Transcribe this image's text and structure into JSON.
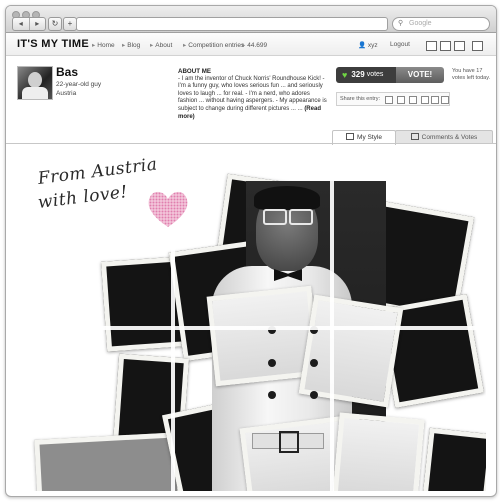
{
  "browser": {
    "nav_back": "◂",
    "nav_forward": "▸",
    "reload_icon": "reload-icon",
    "add_icon": "plus-icon",
    "search_placeholder": "Google"
  },
  "site": {
    "logo": "IT'S MY TIME",
    "nav": [
      {
        "label": "Home"
      },
      {
        "label": "Blog"
      },
      {
        "label": "About"
      },
      {
        "label": "Competition entries"
      },
      {
        "label": "44.699"
      }
    ],
    "user": "xyz",
    "logout": "Logout"
  },
  "profile": {
    "name": "Bas",
    "age_line": "22-year-old guy",
    "country": "Austria",
    "about_heading": "ABOUT ME",
    "about_text": "- I am the inventor of Chuck Norris' Roundhouse Kick! - I'm a funny guy, who loves serious fun ... and seriously loves to laugh ... for real. - I'm a nerd, who adores fashion ... without having aspergers. - My appearance is subject to change during different pictures ... ...",
    "read_more": "(Read more)"
  },
  "votes": {
    "count": "329",
    "unit": "votes",
    "button": "VOTE!",
    "left_note": "You have 17 votes left today."
  },
  "share": {
    "label": "Share this entry:"
  },
  "tabs": {
    "my_style": "My Style",
    "comments": "Comments & Votes"
  },
  "entry": {
    "line1": "From Austria",
    "line2": "with love!"
  },
  "colors": {
    "vote_green": "#6fd443",
    "vote_button": "#6d6d6d",
    "heart_pink": "#e8a3c4"
  }
}
